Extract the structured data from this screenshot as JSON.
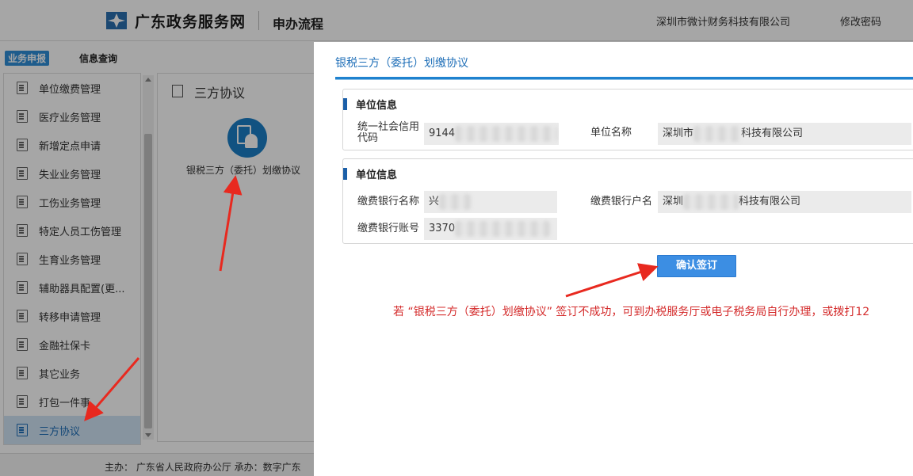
{
  "header": {
    "site_name": "广东政务服务网",
    "page_title": "申办流程",
    "company": "深圳市微计财务科技有限公司",
    "change_password": "修改密码"
  },
  "tabs": {
    "active": "业务申报",
    "other": "信息查询"
  },
  "sidebar": {
    "items": [
      {
        "label": "单位缴费管理"
      },
      {
        "label": "医疗业务管理"
      },
      {
        "label": "新增定点申请"
      },
      {
        "label": "失业业务管理"
      },
      {
        "label": "工伤业务管理"
      },
      {
        "label": "特定人员工伤管理"
      },
      {
        "label": "生育业务管理"
      },
      {
        "label": "辅助器具配置(更..."
      },
      {
        "label": "转移申请管理"
      },
      {
        "label": "金融社保卡"
      },
      {
        "label": "其它业务"
      },
      {
        "label": "打包一件事"
      },
      {
        "label": "三方协议"
      }
    ]
  },
  "content": {
    "title": "三方协议",
    "app_label": "银税三方（委托）划缴协议"
  },
  "footer": {
    "text": "主办：  广东省人民政府办公厅    承办：数字广东"
  },
  "modal": {
    "title": "银税三方（委托）划缴协议",
    "section1": {
      "title": "单位信息",
      "credit_code_label": "统一社会信用代码",
      "credit_code_value": "9144",
      "unit_name_label": "单位名称",
      "unit_name_prefix": "深圳市",
      "unit_name_suffix": "科技有限公司"
    },
    "section2": {
      "title": "单位信息",
      "bank_name_label": "缴费银行名称",
      "bank_name_value": "兴",
      "account_name_label": "缴费银行户名",
      "account_name_prefix": "深圳",
      "account_name_suffix": "科技有限公司",
      "account_no_label": "缴费银行账号",
      "account_no_value": "3370"
    },
    "confirm_label": "确认签订",
    "notice": "若 “银税三方（委托）划缴协议” 签订不成功，可到办税服务厅或电子税务局自行办理，或拨打12"
  },
  "colors": {
    "accent": "#1f82cf",
    "button": "#3c8ee3",
    "notice": "#d42b2b",
    "arrow": "#e8291f"
  }
}
